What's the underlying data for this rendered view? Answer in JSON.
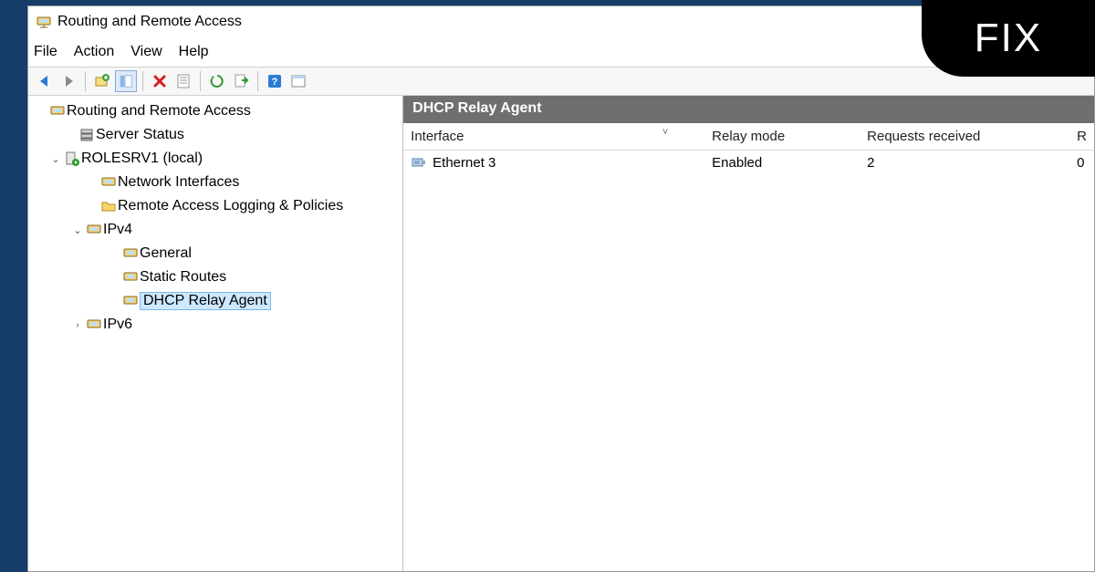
{
  "window": {
    "title": "Routing and Remote Access"
  },
  "menu": {
    "file": "File",
    "action": "Action",
    "view": "View",
    "help": "Help"
  },
  "tree": {
    "root": "Routing and Remote Access",
    "serverStatus": "Server Status",
    "server": "ROLESRV1 (local)",
    "netif": "Network Interfaces",
    "remotelog": "Remote Access Logging & Policies",
    "ipv4": "IPv4",
    "general": "General",
    "staticroutes": "Static Routes",
    "dhcprelay": "DHCP Relay Agent",
    "ipv6": "IPv6"
  },
  "detail": {
    "title": "DHCP Relay Agent",
    "cols": {
      "interface": "Interface",
      "mode": "Relay mode",
      "req": "Requests received",
      "last": "R"
    },
    "rows": [
      {
        "interface": "Ethernet 3",
        "mode": "Enabled",
        "req": "2",
        "last": "0"
      }
    ]
  },
  "badge": "FIX"
}
